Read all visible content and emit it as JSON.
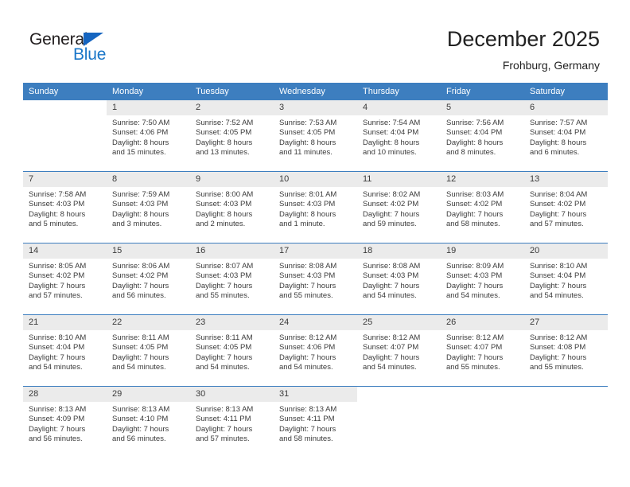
{
  "logo": {
    "word1": "General",
    "word2": "Blue",
    "triangle_color": "#1565c0",
    "blue_color": "#1976c8"
  },
  "header": {
    "title": "December 2025",
    "subtitle": "Frohburg, Germany"
  },
  "theme": {
    "header_blue": "#3d7ebf",
    "daynum_gray": "#ebebeb",
    "text": "#3b3b3b"
  },
  "weekdays": [
    "Sunday",
    "Monday",
    "Tuesday",
    "Wednesday",
    "Thursday",
    "Friday",
    "Saturday"
  ],
  "weeks": [
    [
      {
        "day": "",
        "sunrise": "",
        "sunset": "",
        "daylight1": "",
        "daylight2": ""
      },
      {
        "day": "1",
        "sunrise": "Sunrise: 7:50 AM",
        "sunset": "Sunset: 4:06 PM",
        "daylight1": "Daylight: 8 hours",
        "daylight2": "and 15 minutes."
      },
      {
        "day": "2",
        "sunrise": "Sunrise: 7:52 AM",
        "sunset": "Sunset: 4:05 PM",
        "daylight1": "Daylight: 8 hours",
        "daylight2": "and 13 minutes."
      },
      {
        "day": "3",
        "sunrise": "Sunrise: 7:53 AM",
        "sunset": "Sunset: 4:05 PM",
        "daylight1": "Daylight: 8 hours",
        "daylight2": "and 11 minutes."
      },
      {
        "day": "4",
        "sunrise": "Sunrise: 7:54 AM",
        "sunset": "Sunset: 4:04 PM",
        "daylight1": "Daylight: 8 hours",
        "daylight2": "and 10 minutes."
      },
      {
        "day": "5",
        "sunrise": "Sunrise: 7:56 AM",
        "sunset": "Sunset: 4:04 PM",
        "daylight1": "Daylight: 8 hours",
        "daylight2": "and 8 minutes."
      },
      {
        "day": "6",
        "sunrise": "Sunrise: 7:57 AM",
        "sunset": "Sunset: 4:04 PM",
        "daylight1": "Daylight: 8 hours",
        "daylight2": "and 6 minutes."
      }
    ],
    [
      {
        "day": "7",
        "sunrise": "Sunrise: 7:58 AM",
        "sunset": "Sunset: 4:03 PM",
        "daylight1": "Daylight: 8 hours",
        "daylight2": "and 5 minutes."
      },
      {
        "day": "8",
        "sunrise": "Sunrise: 7:59 AM",
        "sunset": "Sunset: 4:03 PM",
        "daylight1": "Daylight: 8 hours",
        "daylight2": "and 3 minutes."
      },
      {
        "day": "9",
        "sunrise": "Sunrise: 8:00 AM",
        "sunset": "Sunset: 4:03 PM",
        "daylight1": "Daylight: 8 hours",
        "daylight2": "and 2 minutes."
      },
      {
        "day": "10",
        "sunrise": "Sunrise: 8:01 AM",
        "sunset": "Sunset: 4:03 PM",
        "daylight1": "Daylight: 8 hours",
        "daylight2": "and 1 minute."
      },
      {
        "day": "11",
        "sunrise": "Sunrise: 8:02 AM",
        "sunset": "Sunset: 4:02 PM",
        "daylight1": "Daylight: 7 hours",
        "daylight2": "and 59 minutes."
      },
      {
        "day": "12",
        "sunrise": "Sunrise: 8:03 AM",
        "sunset": "Sunset: 4:02 PM",
        "daylight1": "Daylight: 7 hours",
        "daylight2": "and 58 minutes."
      },
      {
        "day": "13",
        "sunrise": "Sunrise: 8:04 AM",
        "sunset": "Sunset: 4:02 PM",
        "daylight1": "Daylight: 7 hours",
        "daylight2": "and 57 minutes."
      }
    ],
    [
      {
        "day": "14",
        "sunrise": "Sunrise: 8:05 AM",
        "sunset": "Sunset: 4:02 PM",
        "daylight1": "Daylight: 7 hours",
        "daylight2": "and 57 minutes."
      },
      {
        "day": "15",
        "sunrise": "Sunrise: 8:06 AM",
        "sunset": "Sunset: 4:02 PM",
        "daylight1": "Daylight: 7 hours",
        "daylight2": "and 56 minutes."
      },
      {
        "day": "16",
        "sunrise": "Sunrise: 8:07 AM",
        "sunset": "Sunset: 4:03 PM",
        "daylight1": "Daylight: 7 hours",
        "daylight2": "and 55 minutes."
      },
      {
        "day": "17",
        "sunrise": "Sunrise: 8:08 AM",
        "sunset": "Sunset: 4:03 PM",
        "daylight1": "Daylight: 7 hours",
        "daylight2": "and 55 minutes."
      },
      {
        "day": "18",
        "sunrise": "Sunrise: 8:08 AM",
        "sunset": "Sunset: 4:03 PM",
        "daylight1": "Daylight: 7 hours",
        "daylight2": "and 54 minutes."
      },
      {
        "day": "19",
        "sunrise": "Sunrise: 8:09 AM",
        "sunset": "Sunset: 4:03 PM",
        "daylight1": "Daylight: 7 hours",
        "daylight2": "and 54 minutes."
      },
      {
        "day": "20",
        "sunrise": "Sunrise: 8:10 AM",
        "sunset": "Sunset: 4:04 PM",
        "daylight1": "Daylight: 7 hours",
        "daylight2": "and 54 minutes."
      }
    ],
    [
      {
        "day": "21",
        "sunrise": "Sunrise: 8:10 AM",
        "sunset": "Sunset: 4:04 PM",
        "daylight1": "Daylight: 7 hours",
        "daylight2": "and 54 minutes."
      },
      {
        "day": "22",
        "sunrise": "Sunrise: 8:11 AM",
        "sunset": "Sunset: 4:05 PM",
        "daylight1": "Daylight: 7 hours",
        "daylight2": "and 54 minutes."
      },
      {
        "day": "23",
        "sunrise": "Sunrise: 8:11 AM",
        "sunset": "Sunset: 4:05 PM",
        "daylight1": "Daylight: 7 hours",
        "daylight2": "and 54 minutes."
      },
      {
        "day": "24",
        "sunrise": "Sunrise: 8:12 AM",
        "sunset": "Sunset: 4:06 PM",
        "daylight1": "Daylight: 7 hours",
        "daylight2": "and 54 minutes."
      },
      {
        "day": "25",
        "sunrise": "Sunrise: 8:12 AM",
        "sunset": "Sunset: 4:07 PM",
        "daylight1": "Daylight: 7 hours",
        "daylight2": "and 54 minutes."
      },
      {
        "day": "26",
        "sunrise": "Sunrise: 8:12 AM",
        "sunset": "Sunset: 4:07 PM",
        "daylight1": "Daylight: 7 hours",
        "daylight2": "and 55 minutes."
      },
      {
        "day": "27",
        "sunrise": "Sunrise: 8:12 AM",
        "sunset": "Sunset: 4:08 PM",
        "daylight1": "Daylight: 7 hours",
        "daylight2": "and 55 minutes."
      }
    ],
    [
      {
        "day": "28",
        "sunrise": "Sunrise: 8:13 AM",
        "sunset": "Sunset: 4:09 PM",
        "daylight1": "Daylight: 7 hours",
        "daylight2": "and 56 minutes."
      },
      {
        "day": "29",
        "sunrise": "Sunrise: 8:13 AM",
        "sunset": "Sunset: 4:10 PM",
        "daylight1": "Daylight: 7 hours",
        "daylight2": "and 56 minutes."
      },
      {
        "day": "30",
        "sunrise": "Sunrise: 8:13 AM",
        "sunset": "Sunset: 4:11 PM",
        "daylight1": "Daylight: 7 hours",
        "daylight2": "and 57 minutes."
      },
      {
        "day": "31",
        "sunrise": "Sunrise: 8:13 AM",
        "sunset": "Sunset: 4:11 PM",
        "daylight1": "Daylight: 7 hours",
        "daylight2": "and 58 minutes."
      },
      {
        "day": "",
        "sunrise": "",
        "sunset": "",
        "daylight1": "",
        "daylight2": ""
      },
      {
        "day": "",
        "sunrise": "",
        "sunset": "",
        "daylight1": "",
        "daylight2": ""
      },
      {
        "day": "",
        "sunrise": "",
        "sunset": "",
        "daylight1": "",
        "daylight2": ""
      }
    ]
  ]
}
